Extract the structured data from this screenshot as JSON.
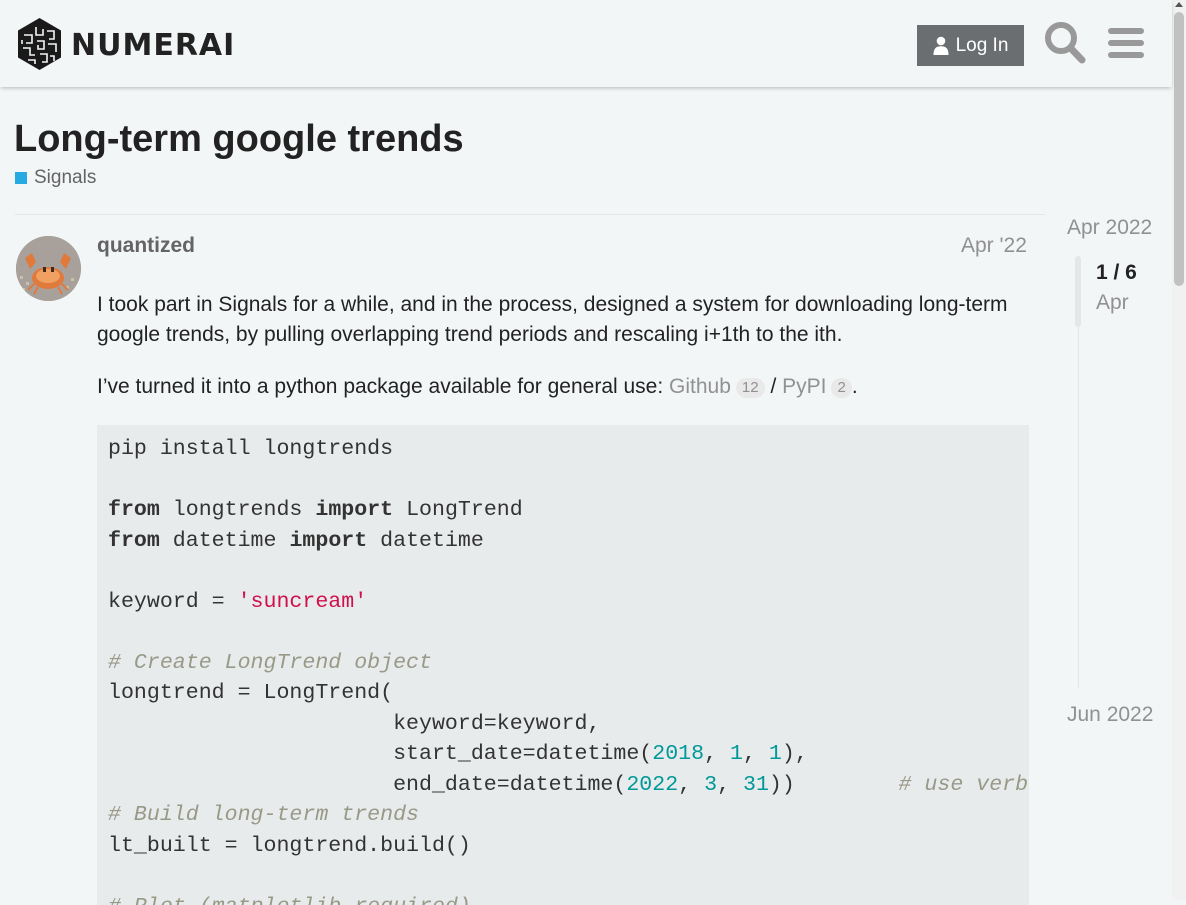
{
  "header": {
    "brand": "NUMERAI",
    "login_label": "Log In"
  },
  "topic": {
    "title": "Long-term google trends",
    "category": "Signals",
    "category_color": "#25aae1"
  },
  "post": {
    "username": "quantized",
    "date": "Apr '22",
    "paragraph1": "I took part in Signals for a while, and in the process, designed a system for downloading long-term google trends, by pulling overlapping trend periods and rescaling i+1th to the ith.",
    "paragraph2_prefix": "I’ve turned it into a python package available for general use: ",
    "github_label": "Github",
    "github_clicks": "12",
    "separator": " / ",
    "pypi_label": "PyPI",
    "pypi_clicks": "2",
    "paragraph2_suffix": "."
  },
  "code": {
    "l1": "pip install longtrends",
    "l3_kw1": "from",
    "l3_mid": " longtrends ",
    "l3_kw2": "import",
    "l3_end": " LongTrend",
    "l4_kw1": "from",
    "l4_mid": " datetime ",
    "l4_kw2": "import",
    "l4_end": " datetime",
    "l6_a": "keyword = ",
    "l6_str": "'suncream'",
    "l8_comment": "# Create LongTrend object",
    "l9": "longtrend = LongTrend(",
    "l10": "                      keyword=keyword,",
    "l11_a": "                      start_date=datetime(",
    "l11_n1": "2018",
    "l11_b": ", ",
    "l11_n2": "1",
    "l11_c": ", ",
    "l11_n3": "1",
    "l11_d": "),",
    "l12_a": "                      end_date=datetime(",
    "l12_n1": "2022",
    "l12_b": ", ",
    "l12_n2": "3",
    "l12_c": ", ",
    "l12_n3": "31",
    "l12_d": "))        ",
    "l12_comment": "# use verb",
    "l13_comment": "# Build long-term trends",
    "l14": "lt_built = longtrend.build()",
    "l16_comment": "# Plot (matplotlib required)"
  },
  "timeline": {
    "start": "Apr 2022",
    "position": "1 / 6",
    "month": "Apr",
    "end": "Jun 2022"
  }
}
